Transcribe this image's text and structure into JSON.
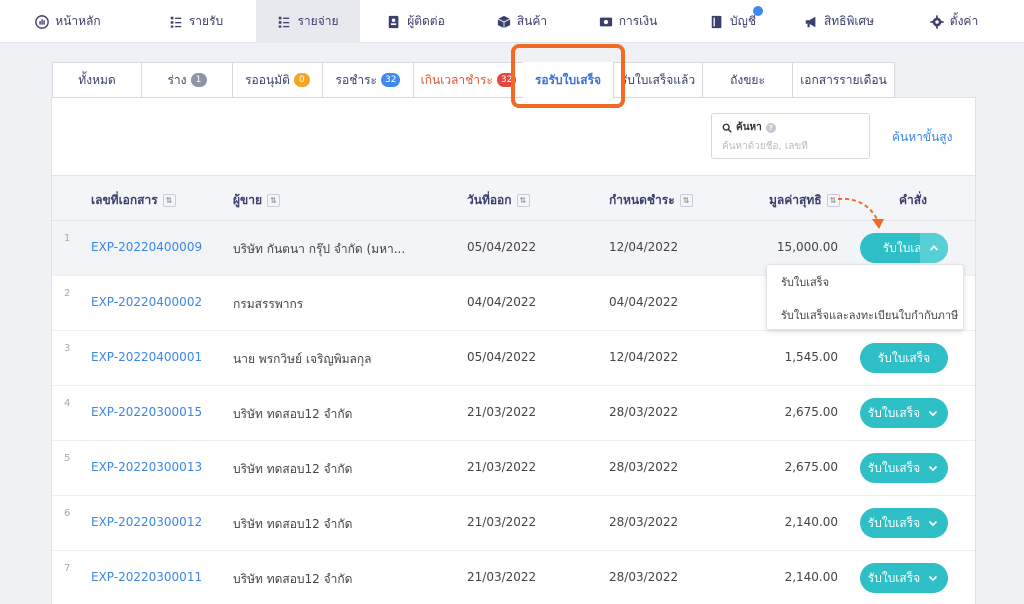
{
  "nav": [
    {
      "label": "หน้าหลัก",
      "icon": "dashboard-icon",
      "active": false
    },
    {
      "label": "รายรับ",
      "icon": "list-icon",
      "active": false
    },
    {
      "label": "รายจ่าย",
      "icon": "list-icon",
      "active": true
    },
    {
      "label": "ผู้ติดต่อ",
      "icon": "contact-icon",
      "active": false
    },
    {
      "label": "สินค้า",
      "icon": "box-icon",
      "active": false
    },
    {
      "label": "การเงิน",
      "icon": "money-icon",
      "active": false
    },
    {
      "label": "บัญชี",
      "icon": "book-icon",
      "active": false
    },
    {
      "label": "สิทธิพิเศษ",
      "icon": "megaphone-icon",
      "active": false
    },
    {
      "label": "ตั้งค่า",
      "icon": "gear-icon",
      "active": false
    }
  ],
  "tabs": [
    {
      "label": "ทั้งหมด",
      "badge": ""
    },
    {
      "label": "ร่าง",
      "badge": "1"
    },
    {
      "label": "รออนุมัติ",
      "badge": "0"
    },
    {
      "label": "รอชำระ",
      "badge": "32"
    },
    {
      "label": "เกินเวลาชำระ",
      "badge": "32"
    },
    {
      "label": "รอรับใบเสร็จ",
      "badge": ""
    },
    {
      "label": "รับใบเสร็จแล้ว",
      "badge": ""
    },
    {
      "label": "ถังขยะ",
      "badge": ""
    },
    {
      "label": "เอกสารรายเดือน",
      "badge": ""
    }
  ],
  "search": {
    "label": "ค้นหา",
    "placeholder": "ค้นหาด้วยชื่อ, เลขที่",
    "advanced": "ค้นหาขั้นสูง"
  },
  "table": {
    "headers": {
      "docno": "เลขที่เอกสาร",
      "vendor": "ผู้ขาย",
      "issue": "วันที่ออก",
      "due": "กำหนดชำระ",
      "amount": "มูลค่าสุทธิ",
      "action": "คำสั่ง"
    },
    "rows": [
      {
        "num": "1",
        "docno": "EXP-20220400009",
        "vendor": "บริษัท กันตนา กรุ๊ป จำกัด (มหา...",
        "issue": "05/04/2022",
        "due": "12/04/2022",
        "amount": "15,000.00",
        "button": "รับใบเสร็จ"
      },
      {
        "num": "2",
        "docno": "EXP-20220400002",
        "vendor": "กรมสรรพากร",
        "issue": "04/04/2022",
        "due": "04/04/2022",
        "amount": "",
        "button": ""
      },
      {
        "num": "3",
        "docno": "EXP-20220400001",
        "vendor": "นาย พรกวิษย์ เจริญพิมลกุล",
        "issue": "05/04/2022",
        "due": "12/04/2022",
        "amount": "1,545.00",
        "button": "รับใบเสร็จ"
      },
      {
        "num": "4",
        "docno": "EXP-20220300015",
        "vendor": "บริษัท ทดสอบ12 จำกัด",
        "issue": "21/03/2022",
        "due": "28/03/2022",
        "amount": "2,675.00",
        "button": "รับใบเสร็จ"
      },
      {
        "num": "5",
        "docno": "EXP-20220300013",
        "vendor": "บริษัท ทดสอบ12 จำกัด",
        "issue": "21/03/2022",
        "due": "28/03/2022",
        "amount": "2,675.00",
        "button": "รับใบเสร็จ"
      },
      {
        "num": "6",
        "docno": "EXP-20220300012",
        "vendor": "บริษัท ทดสอบ12 จำกัด",
        "issue": "21/03/2022",
        "due": "28/03/2022",
        "amount": "2,140.00",
        "button": "รับใบเสร็จ"
      },
      {
        "num": "7",
        "docno": "EXP-20220300011",
        "vendor": "บริษัท ทดสอบ12 จำกัด",
        "issue": "21/03/2022",
        "due": "28/03/2022",
        "amount": "2,140.00",
        "button": "รับใบเสร็จ"
      }
    ]
  },
  "dropdown": {
    "item1": "รับใบเสร็จ",
    "item2": "รับใบเสร็จและลงทะเบียนใบกำกับภาษี"
  },
  "colors": {
    "accent": "#2fbfc7",
    "link": "#3b86e6",
    "highlight": "#f36a27"
  }
}
